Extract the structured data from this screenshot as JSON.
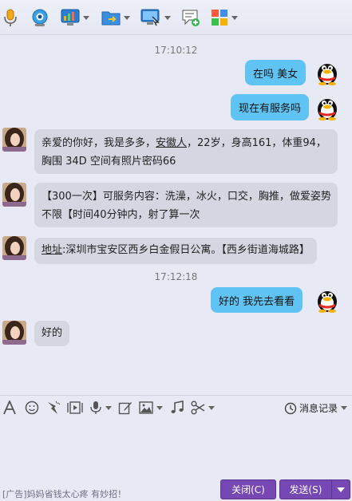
{
  "toolbar": {
    "icons": [
      "microphone-icon",
      "webcam-icon",
      "screen-share-icon",
      "send-file-icon",
      "remote-desktop-icon",
      "add-app-icon",
      "apps-icon"
    ]
  },
  "messages": {
    "timestamp_1": "17:10:12",
    "out_1": "在吗  美女",
    "out_2": "现在有服务吗",
    "in_1_line1_a": "亲爱的你好，我是多多，",
    "in_1_line1_b": "安徽人",
    "in_1_line1_c": "，22岁，身高161，体重94，",
    "in_1_line2": "胸围 34D  空间有照片密码66",
    "in_2_line1": "【300一次】可服务内容：洗澡，冰火，口交，胸推，做爱姿势",
    "in_2_line2": "不限【时间40分钟内，射了算一次",
    "in_3_a": "地址",
    "in_3_b": ":深圳市宝安区西乡白金假日公寓。【西乡街道海城路】",
    "timestamp_2": "17:12:18",
    "out_3": "好的   我先去看看",
    "in_4": "好的"
  },
  "input_toolbar": {
    "icons": [
      "font-icon",
      "emoji-icon",
      "shake-icon",
      "video-icon",
      "voice-icon",
      "edit-icon",
      "image-icon",
      "music-icon",
      "scissors-icon"
    ],
    "history_label": "消息记录"
  },
  "footer": {
    "ad_text": "[广告]妈妈省钱太心疼 有妙招！",
    "close_label": "关闭(C)",
    "send_label": "发送(S)"
  },
  "colors": {
    "outgoing_bubble": "#5fc4f4",
    "incoming_bubble": "#d4d7e2",
    "button": "#7548b3"
  }
}
